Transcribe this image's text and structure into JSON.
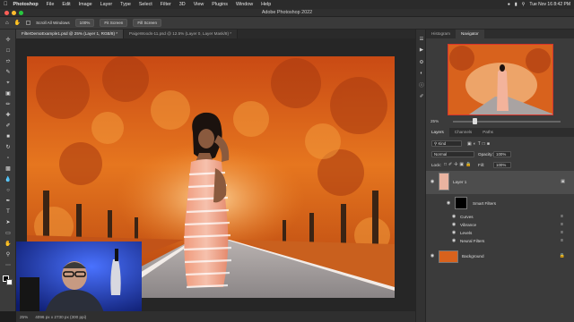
{
  "menubar": {
    "app": "Photoshop",
    "items": [
      "File",
      "Edit",
      "Image",
      "Layer",
      "Type",
      "Select",
      "Filter",
      "3D",
      "View",
      "Plugins",
      "Window",
      "Help"
    ],
    "datetime": "Tue Nov 16  8:42 PM"
  },
  "window": {
    "title": "Adobe Photoshop 2022"
  },
  "options": {
    "scroll_all": "Scroll All Windows",
    "zoom": "100%",
    "fit_screen": "Fit Screen",
    "fill_screen": "Fill Screen"
  },
  "doc_tabs": [
    {
      "label": "FilterDemoExample1.psd @ 25% (Layer 1, RGB/8) *",
      "active": true
    },
    {
      "label": "PaigeWoods-11.psd @ 12.5% (Layer 0, Layer Mask/8) *",
      "active": false
    }
  ],
  "status": {
    "zoom": "25%",
    "dims": "4096 px x 2730 px (300 ppi)"
  },
  "navigator": {
    "tabs": [
      "Histogram",
      "Navigator"
    ],
    "zoom": "25%"
  },
  "layers_panel": {
    "tabs": [
      "Layers",
      "Channels",
      "Paths"
    ],
    "kind": "Kind",
    "blend": "Normal",
    "opacity_label": "Opacity:",
    "opacity": "100%",
    "lock_label": "Lock:",
    "fill_label": "Fill:",
    "fill": "100%",
    "layer1": "Layer 1",
    "smart_filters": "Smart Filters",
    "filters": [
      "Curves",
      "Vibrance",
      "Levels",
      "Neural Filters"
    ],
    "background": "Background"
  },
  "colors": {
    "accent": "#d9342b",
    "panel": "#3b3b3b",
    "dark": "#262626"
  }
}
